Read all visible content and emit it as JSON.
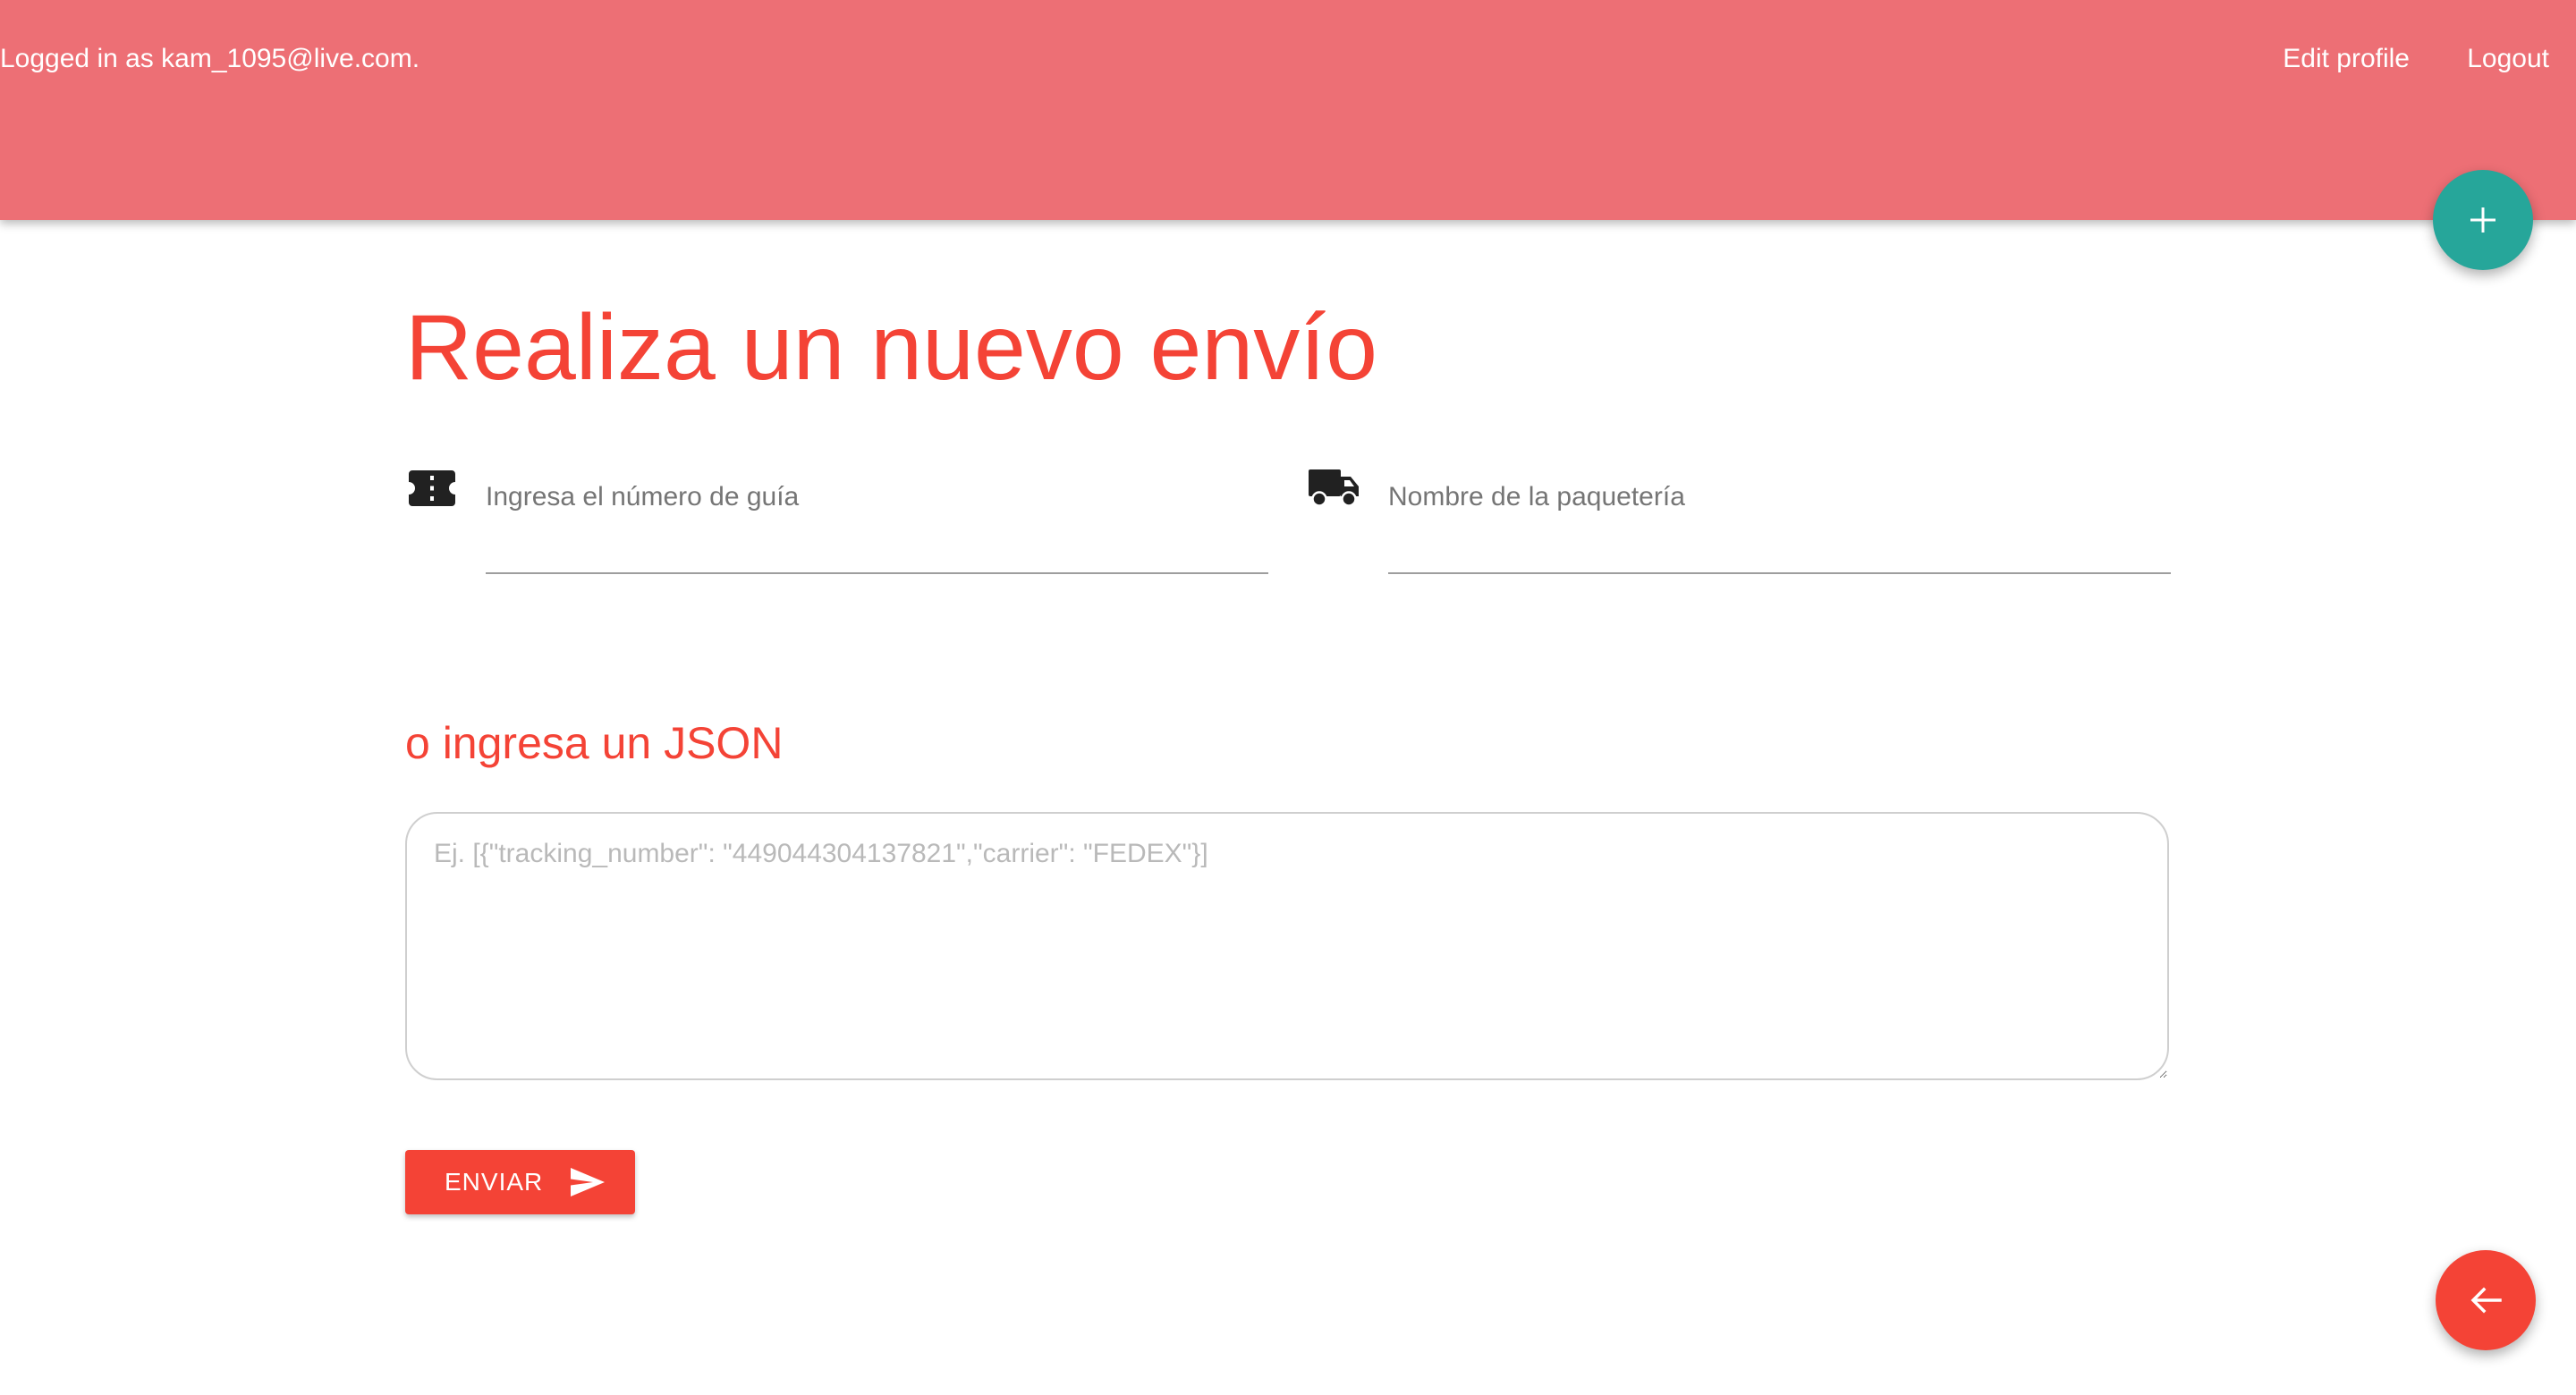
{
  "header": {
    "logged_in_text": "Logged in as kam_1095@live.com.",
    "edit_profile": "Edit profile",
    "logout": "Logout",
    "background_color": "#ed6f75"
  },
  "main": {
    "title": "Realiza un nuevo envío",
    "tracking_field": {
      "icon": "ticket-icon",
      "placeholder": "Ingresa el número de guía",
      "value": ""
    },
    "carrier_field": {
      "icon": "truck-icon",
      "placeholder": "Nombre de la paquetería",
      "value": ""
    },
    "json_subtitle": "o ingresa un JSON",
    "json_textarea": {
      "placeholder": "Ej. [{\"tracking_number\": \"449044304137821\",\"carrier\": \"FEDEX\"}]",
      "value": ""
    },
    "submit_button": {
      "label": "ENVIAR",
      "icon": "send-icon"
    }
  },
  "fabs": {
    "add": {
      "icon": "plus-icon",
      "color": "#26a69a"
    },
    "back": {
      "icon": "arrow-left-icon",
      "color": "#f44336"
    }
  },
  "colors": {
    "accent": "#f44336",
    "teal": "#26a69a"
  }
}
